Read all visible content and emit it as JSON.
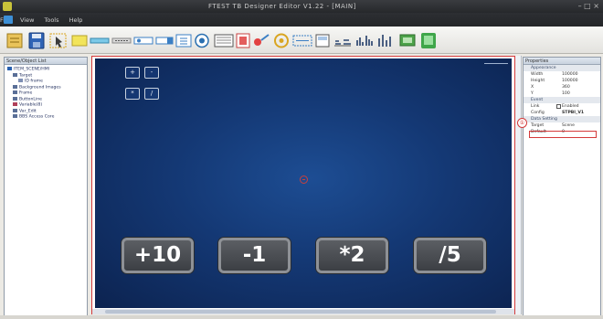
{
  "window": {
    "title": "FTEST TB Designer Editor V1.22 - [MAIN]",
    "controls": "– □ ×"
  },
  "menu": {
    "items": [
      "File",
      "View",
      "Tools",
      "Help"
    ]
  },
  "toolbar": {
    "icons": [
      "new-icon",
      "save-icon",
      "select-icon",
      "button-icon",
      "label-icon",
      "text-icon",
      "edit-icon",
      "combo-icon",
      "grid-icon",
      "image-icon",
      "record-icon",
      "gear-icon",
      "list-icon",
      "frame-icon",
      "slider-icon",
      "chart-icon",
      "bar-chart-icon",
      "export-icon",
      "run-icon"
    ]
  },
  "left_panel": {
    "title": "Scene/Object List",
    "tree": [
      {
        "label": "ITEM_SCENE/HMI",
        "level": 0,
        "color": "#2a62b0"
      },
      {
        "label": "Target",
        "level": 1,
        "color": "#5a6f97"
      },
      {
        "label": "ID frame",
        "level": 2,
        "color": "#7e8fb3"
      },
      {
        "label": "Background Images",
        "level": 1,
        "color": "#5a6f97"
      },
      {
        "label": "Frame",
        "level": 1,
        "color": "#5a6f97"
      },
      {
        "label": "ButtonLine",
        "level": 1,
        "color": "#5a6f97"
      },
      {
        "label": "Variable(8)",
        "level": 1,
        "color": "#b0405a"
      },
      {
        "label": "Var_Edit",
        "level": 1,
        "color": "#5a6f97"
      },
      {
        "label": "BBS Access Core",
        "level": 1,
        "color": "#5a6f97"
      }
    ]
  },
  "canvas": {
    "small_buttons": [
      "+",
      "-",
      "*",
      "/"
    ],
    "big_buttons": [
      "+10",
      "-1",
      "*2",
      "/5"
    ]
  },
  "right_panel": {
    "title": "Properties",
    "annotation": "①",
    "properties": [
      {
        "key": "Appearance",
        "value": "",
        "group": true
      },
      {
        "key": "Width",
        "value": "100000"
      },
      {
        "key": "Height",
        "value": "100000"
      },
      {
        "key": "X",
        "value": "360"
      },
      {
        "key": "Y",
        "value": "100"
      },
      {
        "key": "Event",
        "value": "",
        "group": true
      },
      {
        "key": "Link",
        "value": "Enabled",
        "checkbox": true
      },
      {
        "key": "Config",
        "value": "STPBI_V1",
        "highlight": true
      },
      {
        "key": "Data Setting",
        "value": "",
        "group": true
      },
      {
        "key": "Target",
        "value": "Scene"
      },
      {
        "key": "Default",
        "value": "0"
      }
    ]
  },
  "colors": {
    "scene_bg": "#143874",
    "button_text": "#ffffff",
    "highlight": "#d43a3a"
  }
}
